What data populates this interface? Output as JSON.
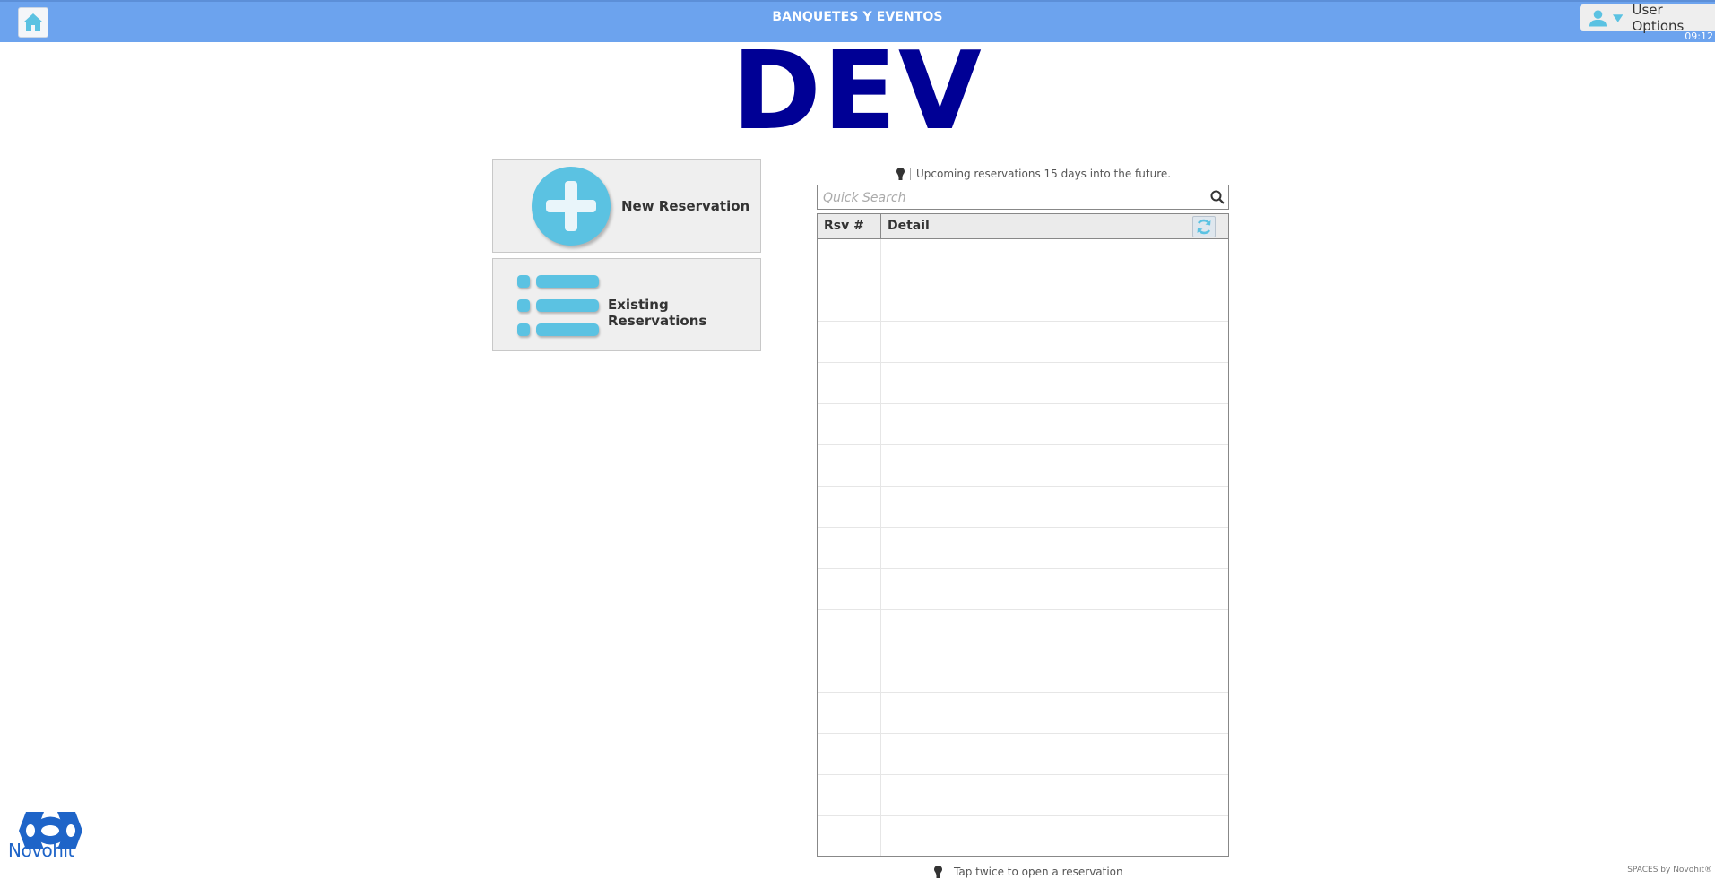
{
  "header": {
    "title": "BANQUETES Y EVENTOS",
    "user_options_label": "User Options",
    "clock": "09:12",
    "bg_color": "#6ca3ee"
  },
  "environment_label": "DEV",
  "actions": {
    "new_reservation": "New Reservation",
    "existing_reservations": "Existing Reservations"
  },
  "upcoming": {
    "hint": "Upcoming reservations 15 days into the future.",
    "search_placeholder": "Quick Search",
    "columns": [
      "Rsv #",
      "Detail"
    ],
    "rows": [],
    "bottom_hint": "Tap twice to open a reservation"
  },
  "brand": {
    "logo_text": "Novohit",
    "footer": "SPACES by Novohit®"
  },
  "colors": {
    "accent": "#5bc2e2",
    "env_title": "#000095",
    "logo": "#1e64c8"
  }
}
